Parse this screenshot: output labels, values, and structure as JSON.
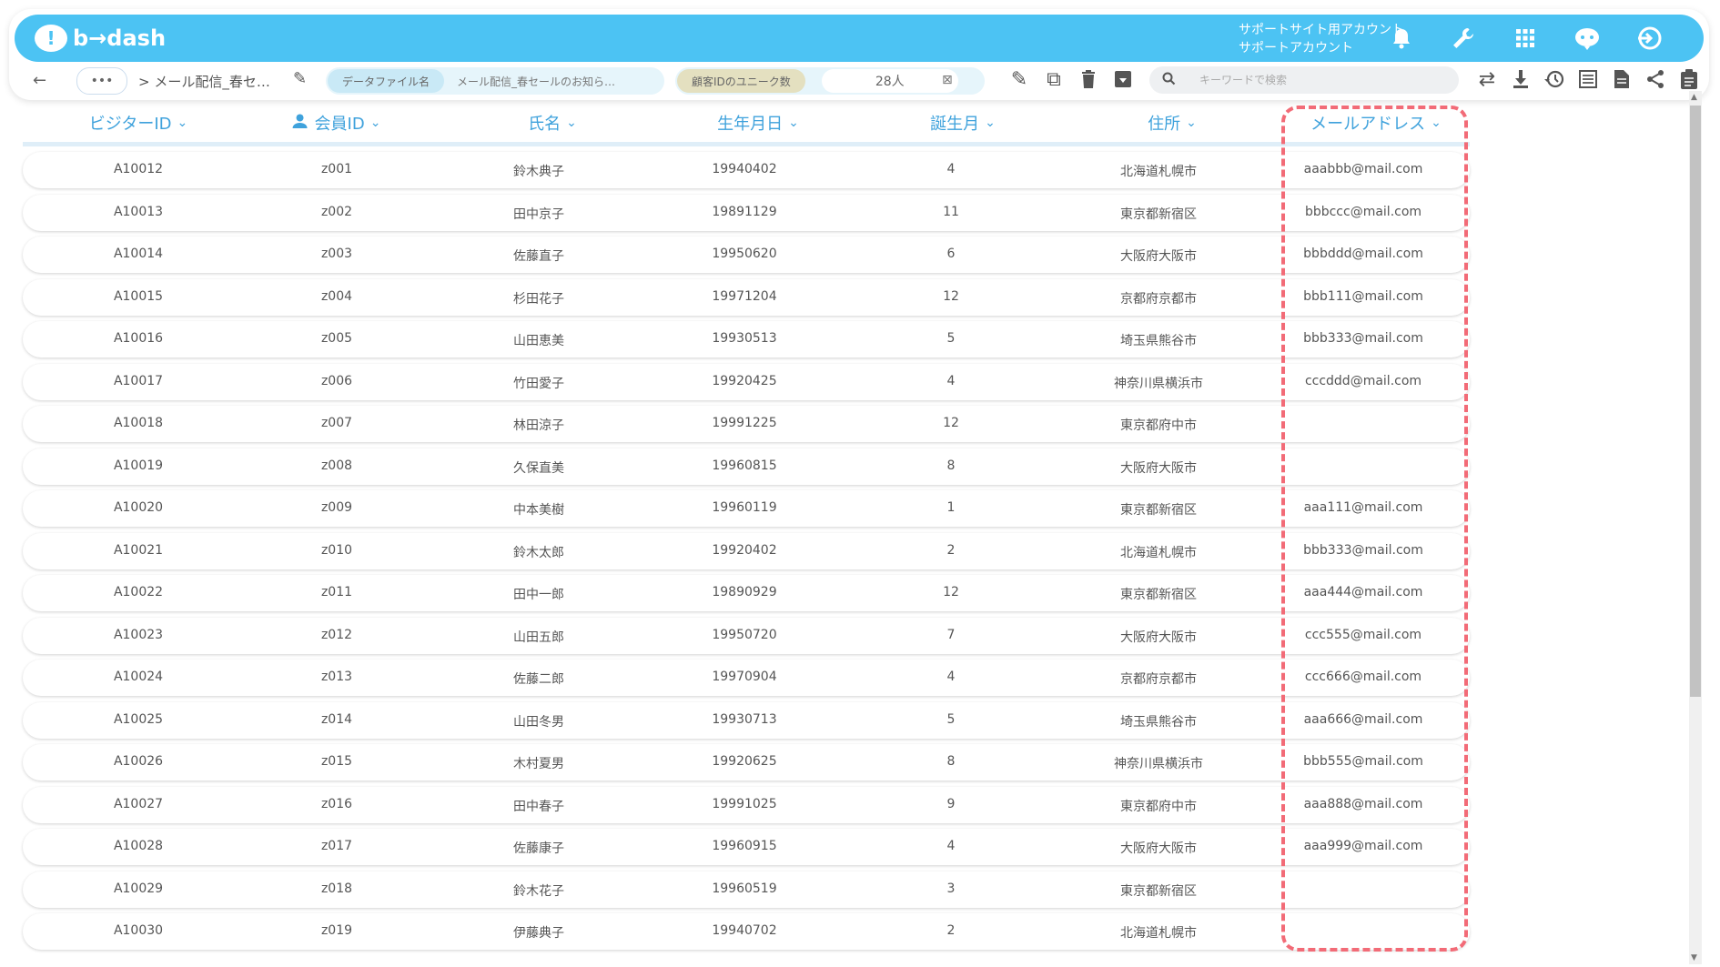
{
  "app": {
    "logo_text": "b→dash",
    "account_line1": "サポートサイト用アカウント",
    "account_line2": "サポートアカウント"
  },
  "top_icons": [
    "bell-icon",
    "wrench-icon",
    "grid-icon",
    "chat-bot-icon",
    "logout-icon"
  ],
  "toolbar": {
    "more_label": "•••",
    "breadcrumb": "> メール配信_春セ…",
    "file_label": "データファイル名",
    "file_value": "メール配信_春セールのお知ら…",
    "unique_label": "顧客IDのユニーク数",
    "unique_value": "28人",
    "search_placeholder": "キーワードで検索"
  },
  "columns": [
    {
      "label": "ビジターID"
    },
    {
      "label": "会員ID"
    },
    {
      "label": "氏名"
    },
    {
      "label": "生年月日"
    },
    {
      "label": "誕生月"
    },
    {
      "label": "住所"
    },
    {
      "label": "メールアドレス"
    }
  ],
  "rows": [
    [
      "A10012",
      "z001",
      "鈴木典子",
      "19940402",
      "4",
      "北海道札幌市",
      "aaabbb@mail.com"
    ],
    [
      "A10013",
      "z002",
      "田中京子",
      "19891129",
      "11",
      "東京都新宿区",
      "bbbccc@mail.com"
    ],
    [
      "A10014",
      "z003",
      "佐藤直子",
      "19950620",
      "6",
      "大阪府大阪市",
      "bbbddd@mail.com"
    ],
    [
      "A10015",
      "z004",
      "杉田花子",
      "19971204",
      "12",
      "京都府京都市",
      "bbb111@mail.com"
    ],
    [
      "A10016",
      "z005",
      "山田恵美",
      "19930513",
      "5",
      "埼玉県熊谷市",
      "bbb333@mail.com"
    ],
    [
      "A10017",
      "z006",
      "竹田愛子",
      "19920425",
      "4",
      "神奈川県横浜市",
      "cccddd@mail.com"
    ],
    [
      "A10018",
      "z007",
      "林田涼子",
      "19991225",
      "12",
      "東京都府中市",
      ""
    ],
    [
      "A10019",
      "z008",
      "久保直美",
      "19960815",
      "8",
      "大阪府大阪市",
      ""
    ],
    [
      "A10020",
      "z009",
      "中本美樹",
      "19960119",
      "1",
      "東京都新宿区",
      "aaa111@mail.com"
    ],
    [
      "A10021",
      "z010",
      "鈴木太郎",
      "19920402",
      "2",
      "北海道札幌市",
      "bbb333@mail.com"
    ],
    [
      "A10022",
      "z011",
      "田中一郎",
      "19890929",
      "12",
      "東京都新宿区",
      "aaa444@mail.com"
    ],
    [
      "A10023",
      "z012",
      "山田五郎",
      "19950720",
      "7",
      "大阪府大阪市",
      "ccc555@mail.com"
    ],
    [
      "A10024",
      "z013",
      "佐藤二郎",
      "19970904",
      "4",
      "京都府京都市",
      "ccc666@mail.com"
    ],
    [
      "A10025",
      "z014",
      "山田冬男",
      "19930713",
      "5",
      "埼玉県熊谷市",
      "aaa666@mail.com"
    ],
    [
      "A10026",
      "z015",
      "木村夏男",
      "19920625",
      "8",
      "神奈川県横浜市",
      "bbb555@mail.com"
    ],
    [
      "A10027",
      "z016",
      "田中春子",
      "19991025",
      "9",
      "東京都府中市",
      "aaa888@mail.com"
    ],
    [
      "A10028",
      "z017",
      "佐藤康子",
      "19960915",
      "4",
      "大阪府大阪市",
      "aaa999@mail.com"
    ],
    [
      "A10029",
      "z018",
      "鈴木花子",
      "19960519",
      "3",
      "東京都新宿区",
      ""
    ],
    [
      "A10030",
      "z019",
      "伊藤典子",
      "19940702",
      "2",
      "北海道札幌市",
      ""
    ]
  ],
  "colors": {
    "brand": "#4cc3f3",
    "header_text": "#3fa2dc",
    "highlight": "#f26b77"
  }
}
